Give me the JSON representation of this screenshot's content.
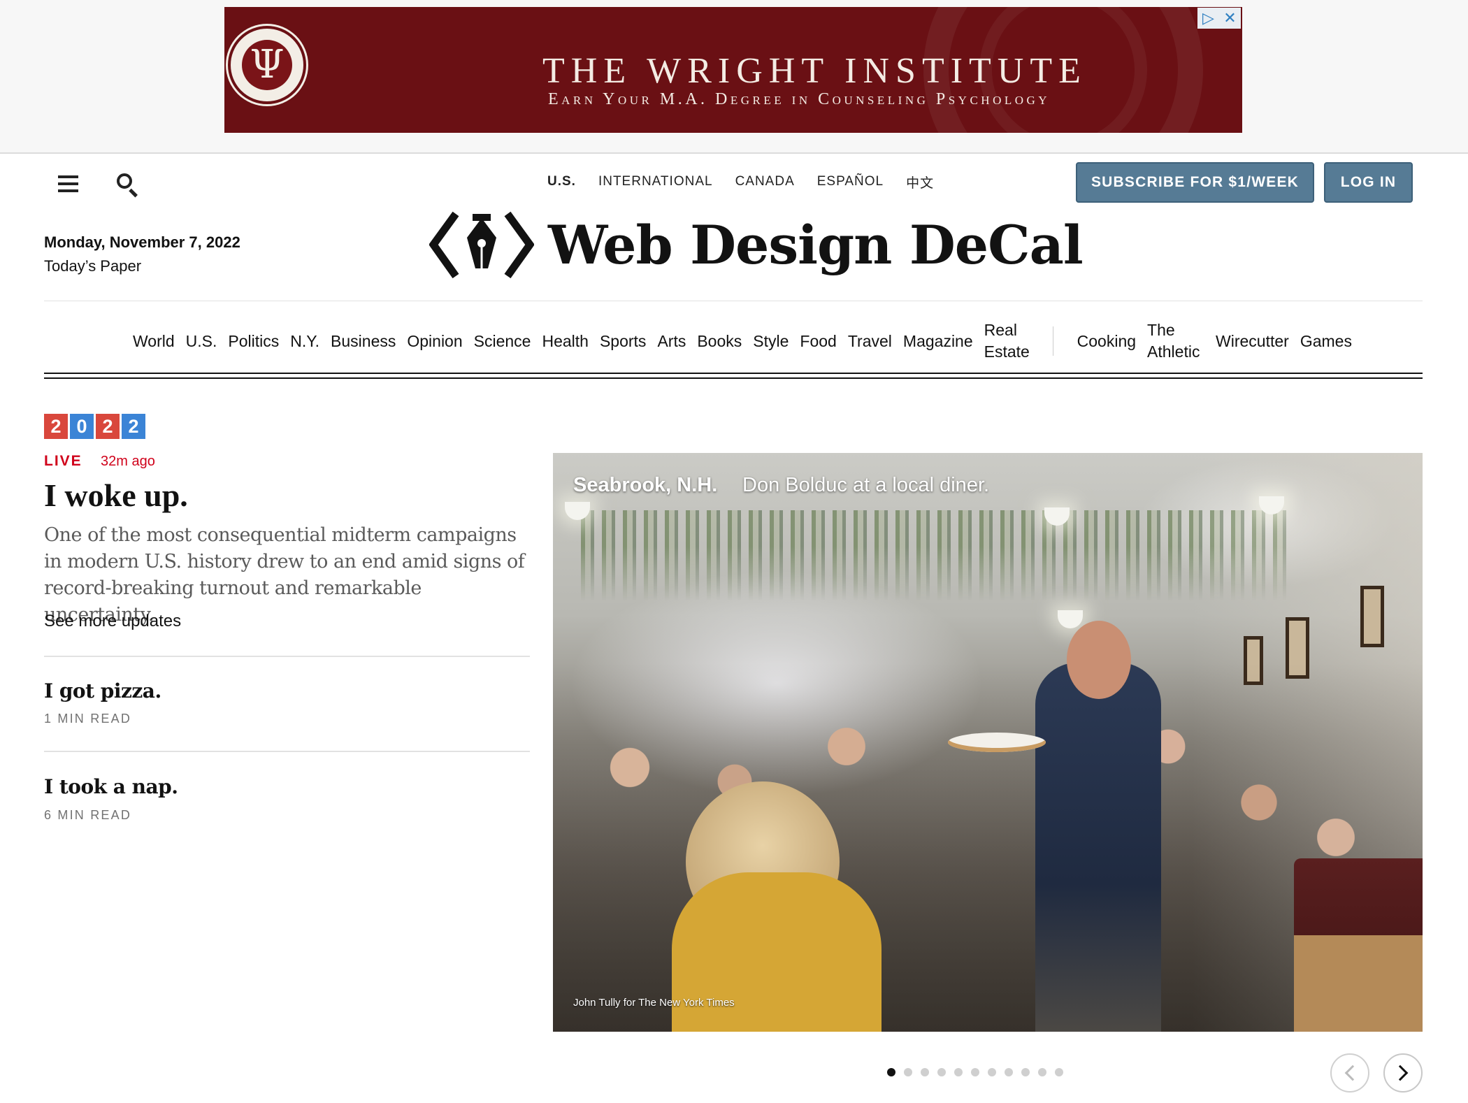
{
  "ad": {
    "title": "THE WRIGHT INSTITUTE",
    "subtitle": "Earn Your M.A. Degree in Counseling Psychology",
    "seal_text": "THE WRIGHT INSTITUTE 1968",
    "seal_glyph": "Ψ",
    "choices_icon": "adchoices-icon",
    "close_icon": "close-icon",
    "background_color": "#6a1014"
  },
  "header": {
    "menu_icon": "hamburger-menu-icon",
    "search_icon": "search-icon",
    "editions": [
      "U.S.",
      "INTERNATIONAL",
      "CANADA",
      "ESPAÑOL",
      "中文"
    ],
    "active_edition": "U.S.",
    "subscribe_label": "SUBSCRIBE FOR $1/WEEK",
    "login_label": "LOG IN",
    "button_color": "#567b95",
    "date": "Monday, November 7, 2022",
    "todays_paper": "Today’s Paper",
    "logo_text": "Web Design DeCal",
    "logo_icon": "pen-nib-code-brackets-icon"
  },
  "sections": {
    "primary": [
      "World",
      "U.S.",
      "Politics",
      "N.Y.",
      "Business",
      "Opinion",
      "Science",
      "Health",
      "Sports",
      "Arts",
      "Books",
      "Style",
      "Food",
      "Travel",
      "Magazine",
      "Real Estate"
    ],
    "secondary": [
      "Cooking",
      "The Athletic",
      "Wirecutter",
      "Games"
    ]
  },
  "lead": {
    "badge_digits": [
      "2",
      "0",
      "2",
      "2"
    ],
    "badge_colors": [
      "#d9473c",
      "#3b84d6"
    ],
    "live_label": "LIVE",
    "timestamp": "32m ago",
    "headline": "I woke up.",
    "summary": "One of the most consequential midterm campaigns in modern U.S. history drew to an end amid signs of record-breaking turnout and remarkable uncertainty.",
    "see_more": "See more updates"
  },
  "stories": [
    {
      "title": "I got pizza.",
      "meta": "1 MIN READ"
    },
    {
      "title": "I took a nap.",
      "meta": "6 MIN READ"
    }
  ],
  "photo": {
    "caption_place": "Seabrook, N.H.",
    "caption_text": "Don Bolduc at a local diner.",
    "credit": "John Tully for The New York Times",
    "description_icon": "diner-photo"
  },
  "carousel": {
    "dot_count": 11,
    "active_index": 0,
    "prev_icon": "chevron-left-icon",
    "next_icon": "chevron-right-icon"
  }
}
